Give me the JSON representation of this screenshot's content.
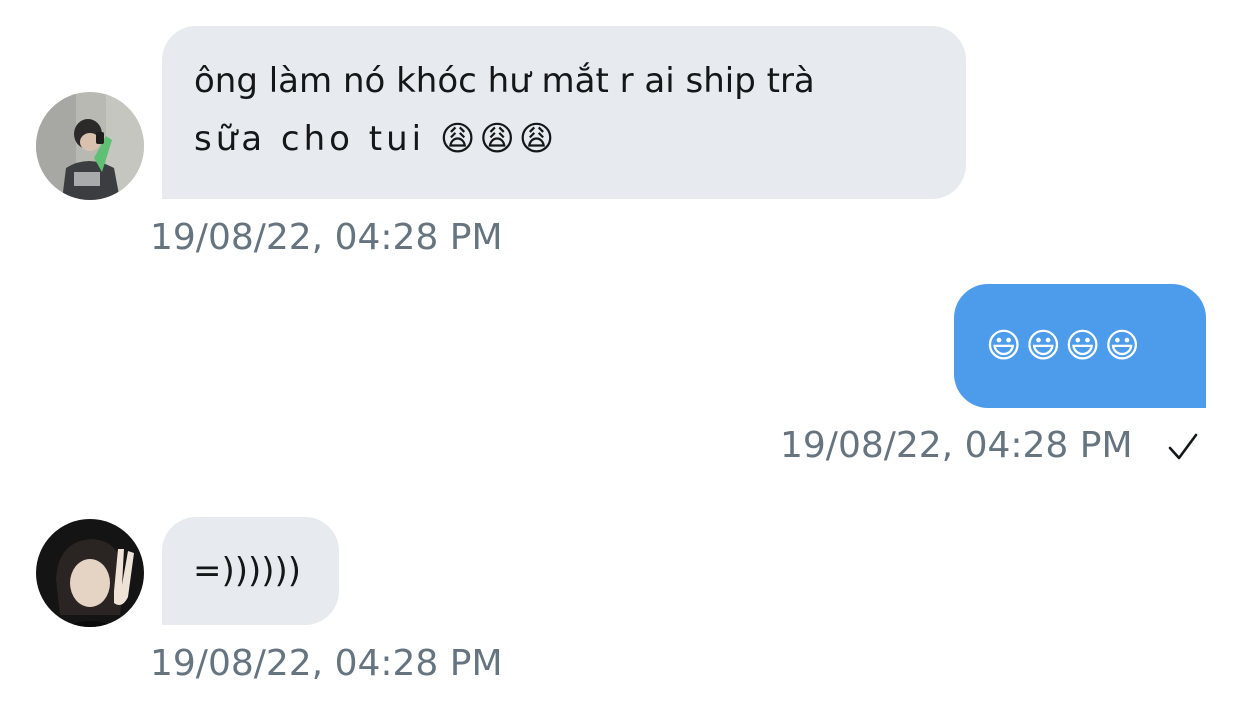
{
  "conversation": {
    "messages": [
      {
        "direction": "incoming",
        "avatar": "avatar-user-green-shirt",
        "text_line1": "ông làm nó khóc hư mắt r ai ship trà",
        "text_line2": "sữa cho tui 😩😩😩",
        "timestamp": "19/08/22, 04:28 PM"
      },
      {
        "direction": "outgoing",
        "text": "😃😃😃😃",
        "timestamp": "19/08/22, 04:28 PM",
        "status_icon": "checkmark-icon"
      },
      {
        "direction": "incoming",
        "avatar": "avatar-user-peace-sign",
        "text": "=))))))",
        "timestamp": "19/08/22, 04:28 PM"
      }
    ]
  },
  "colors": {
    "incoming_bubble": "#e7eaee",
    "outgoing_bubble": "#4c9ceb",
    "timestamp": "#667480"
  }
}
